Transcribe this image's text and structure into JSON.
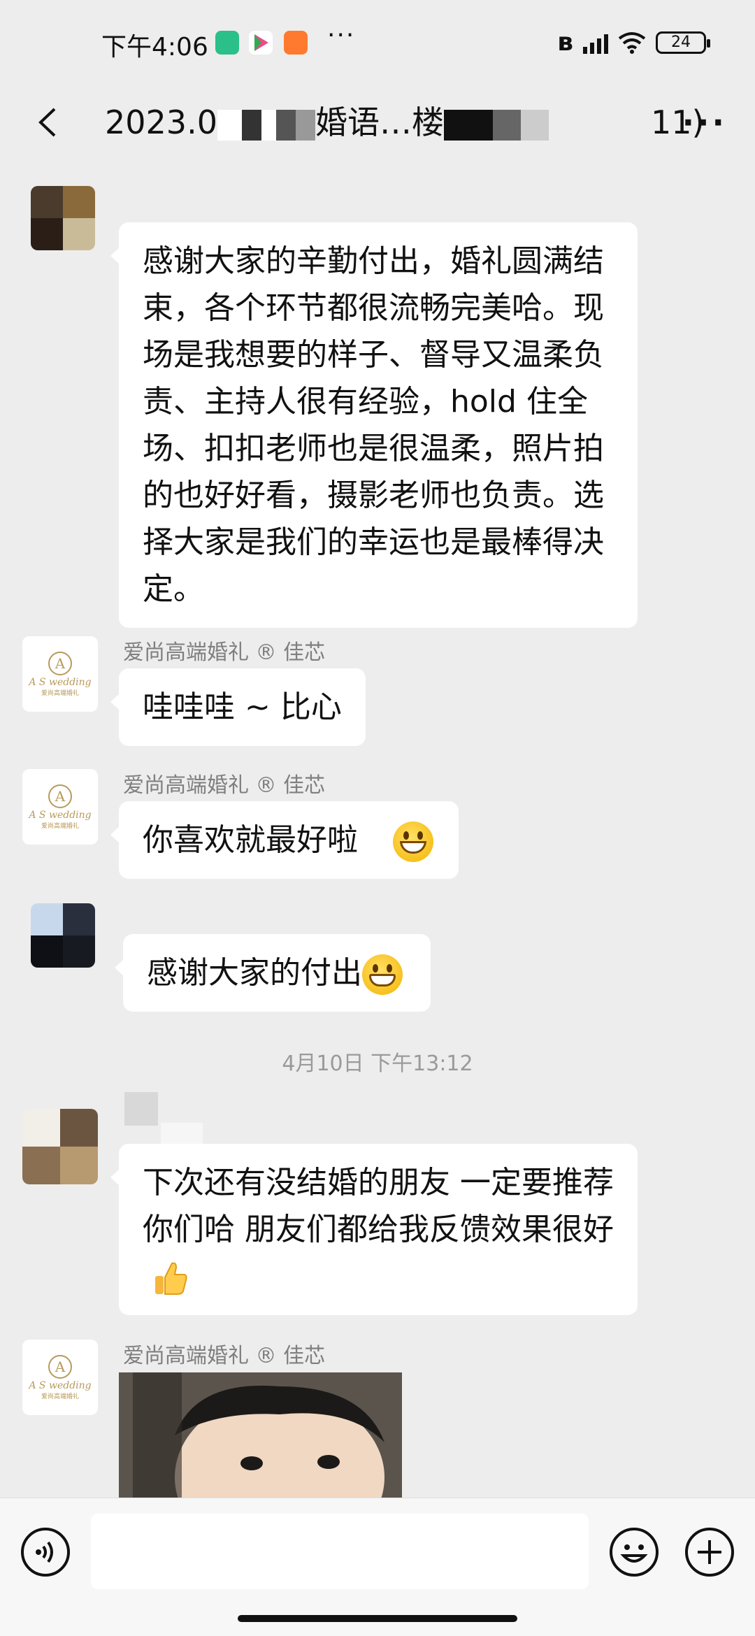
{
  "status_bar": {
    "time": "下午4:06",
    "battery": "24",
    "more": "···"
  },
  "header": {
    "title_prefix": "2023.0",
    "title_mid": "婚语…楼",
    "title_suffix": "11)",
    "more": "···"
  },
  "messages": [
    {
      "sender": "",
      "text": "感谢大家的辛勤付出，婚礼圆满结束，各个环节都很流畅完美哈。现场是我想要的样子、督导又温柔负责、主持人很有经验，hold 住全场、扣扣老师也是很温柔，照片拍的也好好看，摄影老师也负责。选择大家是我们的幸运也是最棒得决定。"
    },
    {
      "sender": "爱尚高端婚礼 ® 佳芯",
      "text": "哇哇哇 ~ 比心"
    },
    {
      "sender": "爱尚高端婚礼 ® 佳芯",
      "text": "你喜欢就最好啦",
      "emoji": "grinning-face"
    },
    {
      "sender": "",
      "text": "感谢大家的付出",
      "emoji": "grinning-face-with-teeth"
    },
    {
      "timestamp": "4月10日 下午13:12"
    },
    {
      "sender": "",
      "text": "下次还有没结婚的朋友 一定要推荐你们哈 朋友们都给我反馈效果很好",
      "emoji": "thumbs-up"
    },
    {
      "sender": "爱尚高端婚礼 ® 佳芯",
      "image": "baby-photo"
    }
  ],
  "brand_avatar": {
    "monogram": "A",
    "script": "A S wedding",
    "small": "爱尚高端婚礼"
  },
  "input": {
    "placeholder": ""
  },
  "colors": {
    "background": "#ededed",
    "bubble": "#ffffff",
    "sender_name": "#7f7f7f",
    "brand_gold": "#b89a5a"
  }
}
